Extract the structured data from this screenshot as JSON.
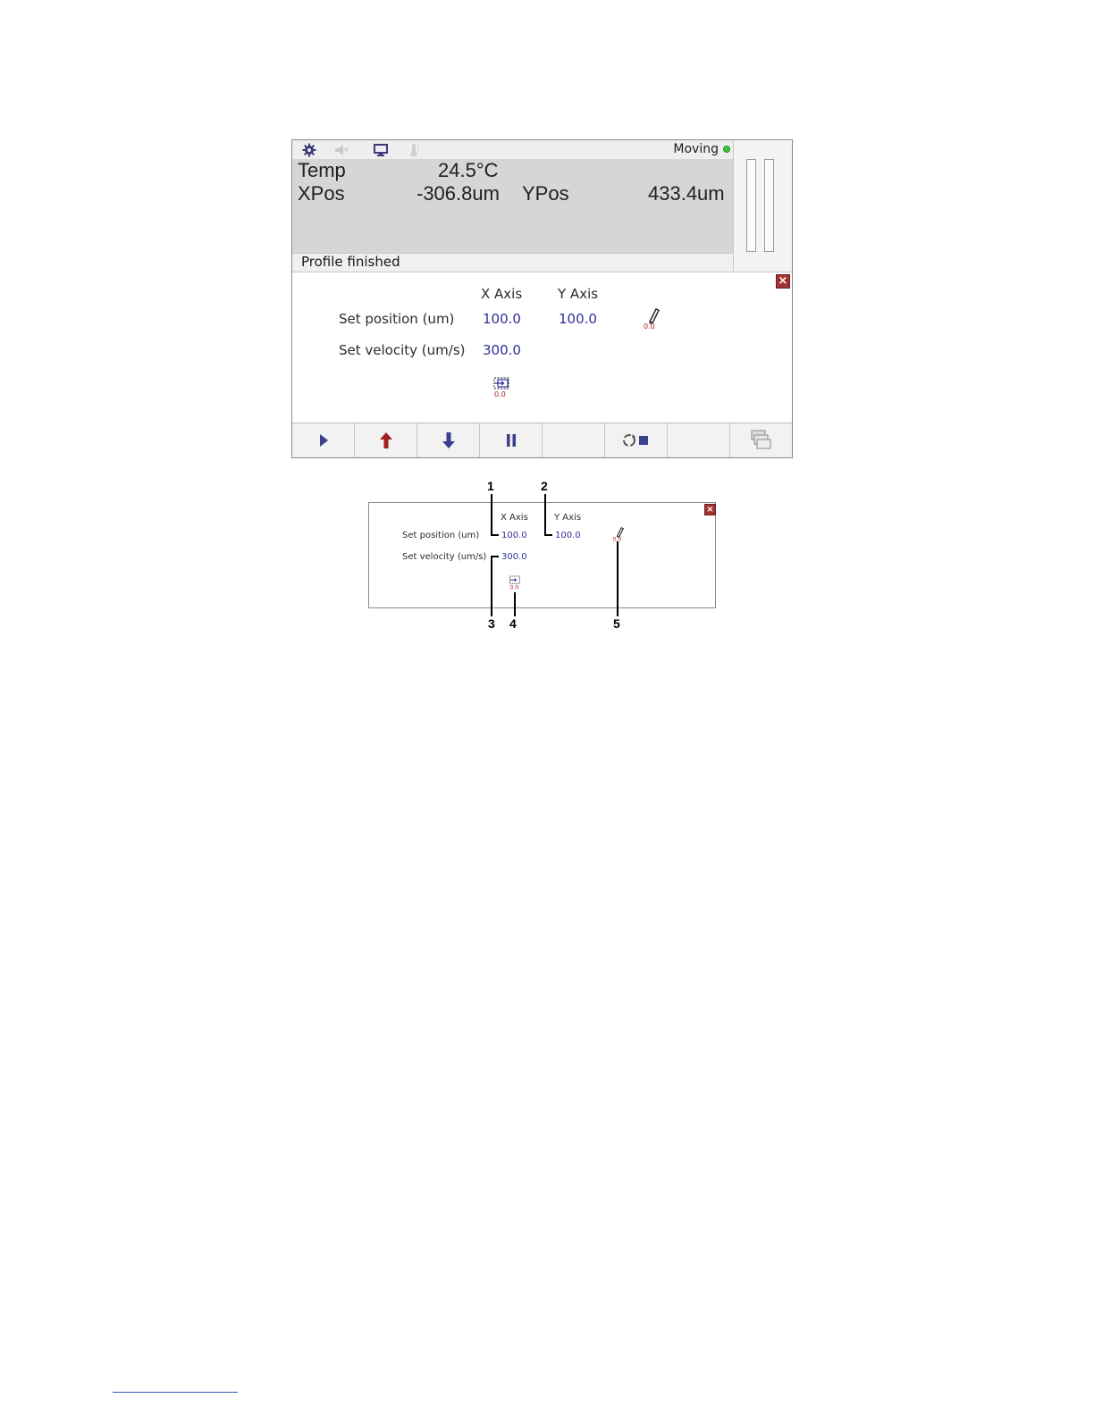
{
  "status_bar": {
    "icons": [
      "gear-icon",
      "speaker-icon",
      "monitor-icon",
      "thermometer-icon"
    ],
    "state_label": "Moving",
    "state_color": "#3cc43c"
  },
  "readout": {
    "temp_label": "Temp",
    "temp_value": "24.5°C",
    "xpos_label": "XPos",
    "xpos_value": "-306.8um",
    "ypos_label": "YPos",
    "ypos_value": "433.4um"
  },
  "message": "Profile finished",
  "panel": {
    "x_axis_header": "X Axis",
    "y_axis_header": "Y Axis",
    "set_position_label": "Set position (um)",
    "set_velocity_label": "Set velocity (um/s)",
    "x_position": "100.0",
    "y_position": "100.0",
    "x_velocity": "300.0",
    "close_glyph": "×"
  },
  "toolbar": {
    "buttons": [
      "play-icon",
      "arrow-up-icon",
      "arrow-down-icon",
      "pause-icon",
      "blank",
      "cycle-stop-icon",
      "blank",
      "windows-icon"
    ]
  },
  "zoom_panel": {
    "x_axis_header": "X Axis",
    "y_axis_header": "Y Axis",
    "set_position_label": "Set position (um)",
    "set_velocity_label": "Set velocity (um/s)",
    "x_position": "100.0",
    "y_position": "100.0",
    "x_velocity": "300.0",
    "close_glyph": "×"
  },
  "callouts": [
    "1",
    "2",
    "3",
    "4",
    "5"
  ],
  "colors": {
    "value_text": "#2f2f9a",
    "close_red": "#a33333",
    "arrow_up_red": "#a32020",
    "toolbar_blue": "#3b3f8c"
  }
}
